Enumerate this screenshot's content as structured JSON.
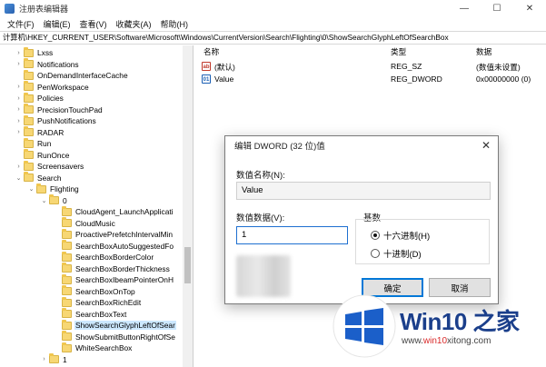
{
  "window": {
    "title": "注册表编辑器",
    "controls": [
      "—",
      "☐",
      "✕"
    ]
  },
  "menu": [
    "文件(F)",
    "编辑(E)",
    "查看(V)",
    "收藏夹(A)",
    "帮助(H)"
  ],
  "address": "计算机\\HKEY_CURRENT_USER\\Software\\Microsoft\\Windows\\CurrentVersion\\Search\\Flighting\\0\\ShowSearchGlyphLeftOfSearchBox",
  "tree": [
    {
      "label": "Lxss",
      "level": 0,
      "chev": "›"
    },
    {
      "label": "Notifications",
      "level": 0,
      "chev": "›"
    },
    {
      "label": "OnDemandInterfaceCache",
      "level": 0,
      "chev": ""
    },
    {
      "label": "PenWorkspace",
      "level": 0,
      "chev": "›"
    },
    {
      "label": "Policies",
      "level": 0,
      "chev": "›"
    },
    {
      "label": "PrecisionTouchPad",
      "level": 0,
      "chev": "›"
    },
    {
      "label": "PushNotifications",
      "level": 0,
      "chev": "›"
    },
    {
      "label": "RADAR",
      "level": 0,
      "chev": "›"
    },
    {
      "label": "Run",
      "level": 0,
      "chev": ""
    },
    {
      "label": "RunOnce",
      "level": 0,
      "chev": ""
    },
    {
      "label": "Screensavers",
      "level": 0,
      "chev": "›"
    },
    {
      "label": "Search",
      "level": 0,
      "chev": "⌄"
    },
    {
      "label": "Flighting",
      "level": 1,
      "chev": "⌄"
    },
    {
      "label": "0",
      "level": 2,
      "chev": "⌄"
    },
    {
      "label": "CloudAgent_LaunchApplicati",
      "level": 3,
      "chev": ""
    },
    {
      "label": "CloudMusic",
      "level": 3,
      "chev": ""
    },
    {
      "label": "ProactivePrefetchIntervalMin",
      "level": 3,
      "chev": ""
    },
    {
      "label": "SearchBoxAutoSuggestedFo",
      "level": 3,
      "chev": ""
    },
    {
      "label": "SearchBoxBorderColor",
      "level": 3,
      "chev": ""
    },
    {
      "label": "SearchBoxBorderThickness",
      "level": 3,
      "chev": ""
    },
    {
      "label": "SearchBoxIbeamPointerOnH",
      "level": 3,
      "chev": ""
    },
    {
      "label": "SearchBoxOnTop",
      "level": 3,
      "chev": ""
    },
    {
      "label": "SearchBoxRichEdit",
      "level": 3,
      "chev": ""
    },
    {
      "label": "SearchBoxText",
      "level": 3,
      "chev": ""
    },
    {
      "label": "ShowSearchGlyphLeftOfSear",
      "level": 3,
      "chev": "",
      "selected": true
    },
    {
      "label": "ShowSubmitButtonRightOfSe",
      "level": 3,
      "chev": ""
    },
    {
      "label": "WhiteSearchBox",
      "level": 3,
      "chev": ""
    },
    {
      "label": "1",
      "level": 2,
      "chev": "›"
    }
  ],
  "list": {
    "headers": {
      "name": "名称",
      "type": "类型",
      "data": "数据"
    },
    "rows": [
      {
        "icon": "ab",
        "name": "(默认)",
        "type": "REG_SZ",
        "data": "(数值未设置)"
      },
      {
        "icon": "01",
        "name": "Value",
        "type": "REG_DWORD",
        "data": "0x00000000 (0)"
      }
    ]
  },
  "dialog": {
    "title": "编辑 DWORD (32 位)值",
    "close": "✕",
    "name_label": "数值名称(N):",
    "name_value": "Value",
    "data_label": "数值数据(V):",
    "data_value": "1",
    "base_label": "基数",
    "hex_label": "十六进制(H)",
    "dec_label": "十进制(D)",
    "base_selected": "hex",
    "ok_label": "确定",
    "cancel_label": "取消"
  },
  "watermark": {
    "brand": "Win10 之家",
    "url_prefix": "www.",
    "url_highlight": "win10",
    "url_suffix": "xitong.com",
    "colors": {
      "blue": "#1b5fc9",
      "red": "#d92b2b"
    }
  }
}
